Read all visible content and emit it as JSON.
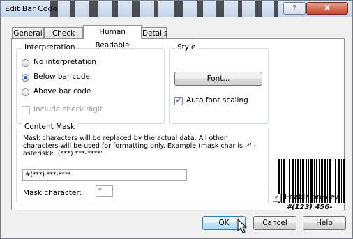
{
  "window": {
    "title": "Edit Bar Code",
    "help_label": "?",
    "close_label": "X"
  },
  "tabs": [
    {
      "label": "General"
    },
    {
      "label": "Check Digit"
    },
    {
      "label": "Human Readable"
    },
    {
      "label": "Details"
    }
  ],
  "interpretation": {
    "legend": "Interpretation",
    "options": [
      {
        "label": "No interpretation",
        "selected": false
      },
      {
        "label": "Below bar code",
        "selected": true
      },
      {
        "label": "Above bar code",
        "selected": false
      }
    ],
    "include_check_digit": {
      "label": "Include check digit",
      "checked": false,
      "enabled": false
    }
  },
  "style": {
    "legend": "Style",
    "font_button": "Font...",
    "auto_font_scaling": {
      "label": "Auto font scaling",
      "checked": true
    }
  },
  "content_mask": {
    "legend": "Content Mask",
    "description": "Mask characters will be replaced by the actual data. All other characters will be used for formatting only. Example (mask char is '*' - asterisk): '(***) ***-****'",
    "mask_value": "#(***) ***-****",
    "mask_char_label": "Mask character:",
    "mask_char_value": "*"
  },
  "preview": {
    "human_readable_text": "#(123) 456-",
    "enable_preview": {
      "label": "Enable preview",
      "checked": true
    }
  },
  "footer": {
    "ok": "OK",
    "cancel": "Cancel",
    "help": "Help"
  }
}
